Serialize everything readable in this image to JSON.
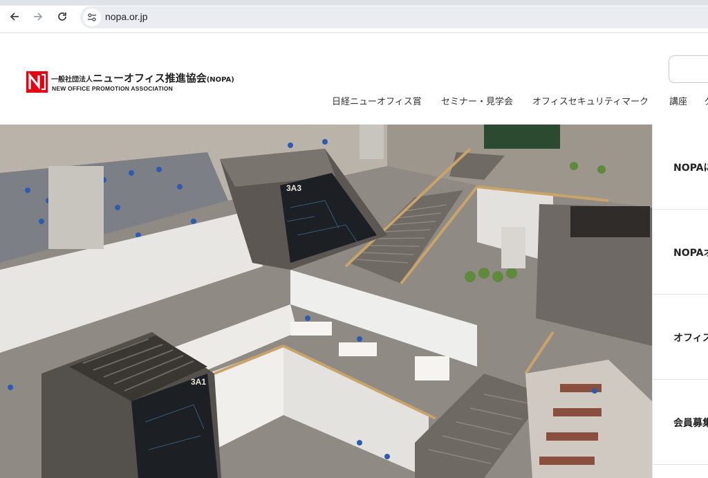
{
  "browser": {
    "url": "nopa.or.jp",
    "icons": [
      "back-arrow-icon",
      "forward-arrow-icon",
      "reload-icon",
      "site-info-icon"
    ]
  },
  "site": {
    "logo_jp_small": "一般社団法人",
    "logo_jp_main": "ニューオフィス推進協会",
    "logo_jp_suffix": "(NOPA)",
    "logo_en": "NEW OFFICE PROMOTION ASSOCIATION",
    "brand_color": "#e60012"
  },
  "nav": {
    "items": [
      "日経ニューオフィス賞",
      "セミナー・見学会",
      "オフィスセキュリティマーク",
      "講座",
      "ク"
    ]
  },
  "side_menu": {
    "items": [
      "NOPAに",
      "NOPAオ",
      "オフィス",
      "会員募集"
    ]
  },
  "hero": {
    "pod_label_1": "3A3",
    "pod_label_2": "3A1"
  }
}
